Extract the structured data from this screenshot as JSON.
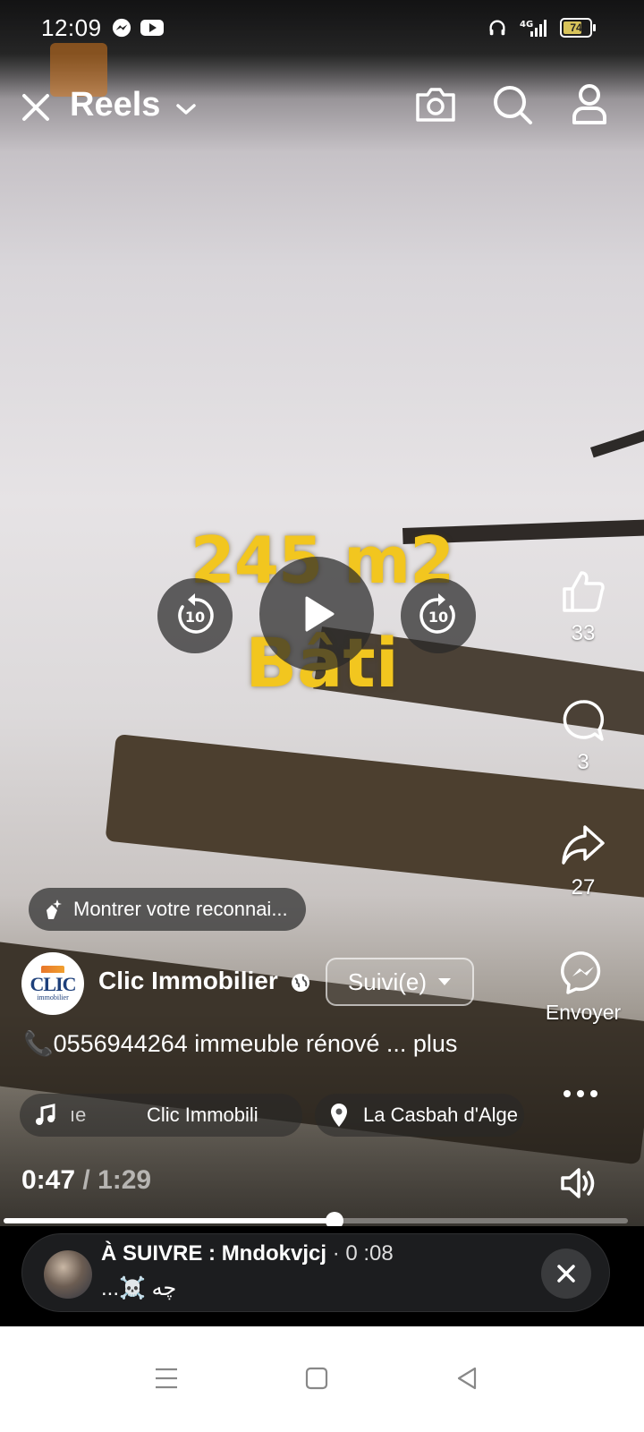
{
  "status_bar": {
    "time": "12:09",
    "icons": [
      "messenger-icon",
      "youtube-icon",
      "headphones-icon",
      "4g-signal-icon",
      "battery-icon"
    ],
    "network": "4G",
    "battery_percent": "74",
    "battery_level": 0.74
  },
  "header": {
    "title": "Reels",
    "icons": [
      "close-icon",
      "chevron-down-icon",
      "camera-icon",
      "search-icon",
      "profile-icon"
    ]
  },
  "video": {
    "overlay_line1": "245 m2",
    "overlay_line2": "Bâti",
    "rewind_label": "10",
    "forward_label": "10",
    "current_time": "0:47",
    "separator": " / ",
    "total_time": "1:29",
    "progress": 0.53
  },
  "actions": {
    "likes": "33",
    "comments": "3",
    "shares": "27",
    "send_label": "Envoyer"
  },
  "appreciation_chip": {
    "label": "Montrer votre reconnai..."
  },
  "author": {
    "name": "Clic Immobilier",
    "avatar_text": "CLIC",
    "avatar_subtext": "immobilier",
    "follow_label": "Suivi(e)"
  },
  "caption": {
    "text": "📞0556944264 immeuble rénové ... plus"
  },
  "tags": {
    "audio_fragment": "ıe",
    "audio_author": "Clic Immobili",
    "location": "La Casbah d'Alge"
  },
  "up_next": {
    "prefix": "À SUIVRE : ",
    "author": "Mndokvjcj",
    "duration": " · 0 :08",
    "subtitle": "...☠️ چه"
  },
  "colors": {
    "overlay_text": "#f2c61f",
    "battery_fill": "#d8c35a",
    "clic_blue": "#1d3f7a",
    "navbar_bg": "#ffffff"
  }
}
